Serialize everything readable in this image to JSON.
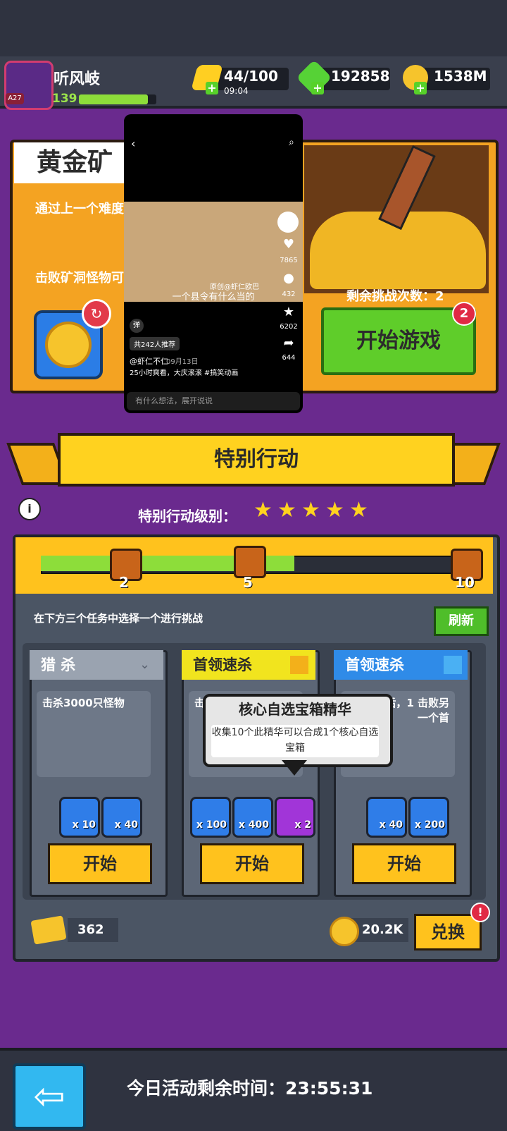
{
  "player": {
    "name": "听风岐",
    "avatar_level": "A27",
    "xp": "139"
  },
  "resources": {
    "energy": "44/100",
    "energy_timer": "09:04",
    "gems": "192858",
    "gold": "1538M"
  },
  "mine": {
    "title": "黄金矿",
    "line1": "通过上一个难度",
    "line2": "击败矿洞怪物可",
    "remaining_label": "剩余挑战次数：2",
    "start_label": "开始游戏",
    "badge": "2"
  },
  "video_overlay": {
    "subtitle": "一个县令有什么当的",
    "watermark": "原创@虾仁欧巴",
    "likes": "7865",
    "comments": "432",
    "favorites": "6202",
    "shares": "644",
    "recommend": "共242人推荐",
    "author": "@虾仁不仁",
    "date": "09月13日",
    "desc": "25小时爽看，大庆滚滚 #搞笑动画",
    "comment_placeholder": "有什么想法，展开说说",
    "tag": "弹"
  },
  "special": {
    "banner": "特别行动",
    "level_label": "特别行动级别：",
    "stars": 5,
    "progress": {
      "milestones": [
        "2",
        "5",
        "10"
      ],
      "filled_fraction": 0.6
    },
    "instruction": "在下方三个任务中选择一个进行挑战",
    "refresh_label": "刷新",
    "tasks": [
      {
        "title": "猎  杀",
        "desc": "击杀3000只怪物",
        "rewards": [
          "x 10",
          "x 40"
        ],
        "start": "开始"
      },
      {
        "title": "首领速杀",
        "desc": "击",
        "rewards": [
          "x 100",
          "x 400",
          "x 2"
        ],
        "start": "开始"
      },
      {
        "title": "首领速杀",
        "desc": "个首领后，1 击败另一个首",
        "rewards": [
          "x 40",
          "x 200"
        ],
        "start": "开始"
      }
    ],
    "tooltip": {
      "title": "核心自选宝箱精华",
      "body": "收集10个此精华可以合成1个核心自选宝箱"
    },
    "tickets": "362",
    "coins": "20.2K",
    "exchange_label": "兑换"
  },
  "footer": {
    "timer_text": "今日活动剩余时间：23:55:31"
  }
}
